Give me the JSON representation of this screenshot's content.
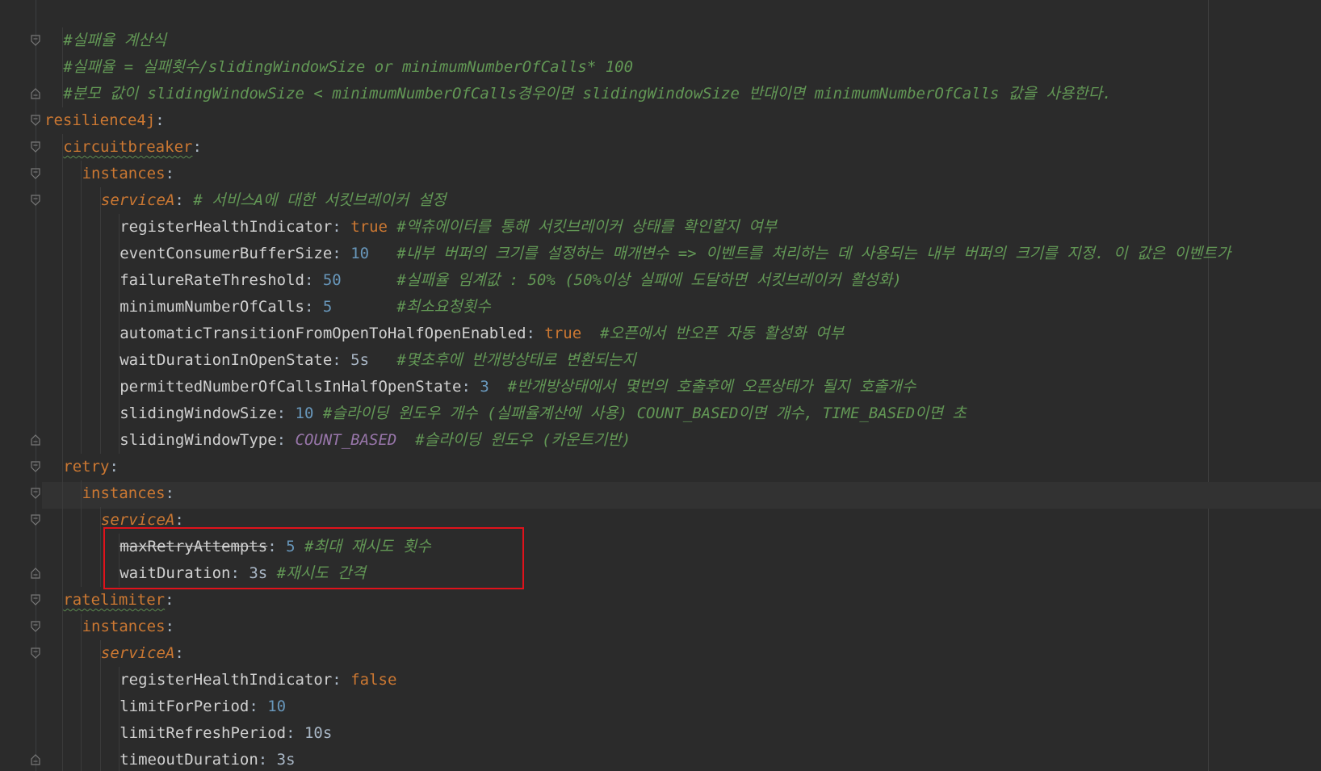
{
  "editor": {
    "language": "yaml",
    "colors": {
      "background": "#2b2b2b",
      "comment": "#629755",
      "key": "#cc7832",
      "number": "#6897bb",
      "enum": "#9876aa",
      "text": "#a9b7c6",
      "highlight_box": "#e0121b"
    },
    "lines": [
      {
        "indent": 1,
        "fold": "open",
        "segments": [
          {
            "cls": "c",
            "text": "#실패율 계산식"
          }
        ]
      },
      {
        "indent": 1,
        "fold": "",
        "segments": [
          {
            "cls": "c",
            "text": "#실패율 = 실패횟수/slidingWindowSize or minimumNumberOfCalls* 100"
          }
        ]
      },
      {
        "indent": 1,
        "fold": "close",
        "segments": [
          {
            "cls": "c",
            "text": "#분모 값이 slidingWindowSize < minimumNumberOfCalls경우이면 slidingWindowSize 반대이면 minimumNumberOfCalls 값을 사용한다."
          }
        ]
      },
      {
        "indent": 0,
        "fold": "open",
        "segments": [
          {
            "cls": "k",
            "text": "resilience4j"
          },
          {
            "cls": "p",
            "text": ":"
          }
        ]
      },
      {
        "indent": 1,
        "fold": "open",
        "segments": [
          {
            "cls": "k sq",
            "text": "circuitbreaker"
          },
          {
            "cls": "p",
            "text": ":"
          }
        ]
      },
      {
        "indent": 2,
        "fold": "open",
        "segments": [
          {
            "cls": "k",
            "text": "instances"
          },
          {
            "cls": "p",
            "text": ":"
          }
        ]
      },
      {
        "indent": 3,
        "fold": "open",
        "segments": [
          {
            "cls": "ki",
            "text": "serviceA"
          },
          {
            "cls": "p",
            "text": ": "
          },
          {
            "cls": "c",
            "text": "# 서비스A에 대한 서킷브레이커 설정"
          }
        ]
      },
      {
        "indent": 4,
        "fold": "",
        "segments": [
          {
            "cls": "keyc",
            "text": "registerHealthIndicator"
          },
          {
            "cls": "p",
            "text": ": "
          },
          {
            "cls": "bool",
            "text": "true"
          },
          {
            "cls": "p",
            "text": " "
          },
          {
            "cls": "c",
            "text": "#액츄에이터를 통해 서킷브레이커 상태를 확인할지 여부"
          }
        ]
      },
      {
        "indent": 4,
        "fold": "",
        "segments": [
          {
            "cls": "keyc",
            "text": "eventConsumerBufferSize"
          },
          {
            "cls": "p",
            "text": ": "
          },
          {
            "cls": "num",
            "text": "10"
          },
          {
            "cls": "p",
            "text": "   "
          },
          {
            "cls": "c",
            "text": "#내부 버퍼의 크기를 설정하는 매개변수 => 이벤트를 처리하는 데 사용되는 내부 버퍼의 크기를 지정. 이 값은 이벤트가"
          }
        ]
      },
      {
        "indent": 4,
        "fold": "",
        "segments": [
          {
            "cls": "keyc",
            "text": "failureRateThreshold"
          },
          {
            "cls": "p",
            "text": ": "
          },
          {
            "cls": "num",
            "text": "50"
          },
          {
            "cls": "p",
            "text": "      "
          },
          {
            "cls": "c",
            "text": "#실패율 임계값 : 50% (50%이상 실패에 도달하면 서킷브레이커 활성화)"
          }
        ]
      },
      {
        "indent": 4,
        "fold": "",
        "segments": [
          {
            "cls": "keyc",
            "text": "minimumNumberOfCalls"
          },
          {
            "cls": "p",
            "text": ": "
          },
          {
            "cls": "num",
            "text": "5"
          },
          {
            "cls": "p",
            "text": "       "
          },
          {
            "cls": "c",
            "text": "#최소요청횟수"
          }
        ]
      },
      {
        "indent": 4,
        "fold": "",
        "segments": [
          {
            "cls": "keyc",
            "text": "automaticTransitionFromOpenToHalfOpenEnabled"
          },
          {
            "cls": "p",
            "text": ": "
          },
          {
            "cls": "bool",
            "text": "true"
          },
          {
            "cls": "p",
            "text": "  "
          },
          {
            "cls": "c",
            "text": "#오픈에서 반오픈 자동 활성화 여부"
          }
        ]
      },
      {
        "indent": 4,
        "fold": "",
        "segments": [
          {
            "cls": "keyc",
            "text": "waitDurationInOpenState"
          },
          {
            "cls": "p",
            "text": ": 5s   "
          },
          {
            "cls": "c",
            "text": "#몇초후에 반개방상태로 변환되는지"
          }
        ]
      },
      {
        "indent": 4,
        "fold": "",
        "segments": [
          {
            "cls": "keyc",
            "text": "permittedNumberOfCallsInHalfOpenState"
          },
          {
            "cls": "p",
            "text": ": "
          },
          {
            "cls": "num",
            "text": "3"
          },
          {
            "cls": "p",
            "text": "  "
          },
          {
            "cls": "c",
            "text": "#반개방상태에서 몇번의 호출후에 오픈상태가 될지 호출개수"
          }
        ]
      },
      {
        "indent": 4,
        "fold": "",
        "segments": [
          {
            "cls": "keyc",
            "text": "slidingWindowSize"
          },
          {
            "cls": "p",
            "text": ": "
          },
          {
            "cls": "num",
            "text": "10"
          },
          {
            "cls": "p",
            "text": " "
          },
          {
            "cls": "c",
            "text": "#슬라이딩 윈도우 개수 (실패율계산에 사용) COUNT_BASED이면 개수, TIME_BASED이면 초"
          }
        ]
      },
      {
        "indent": 4,
        "fold": "close",
        "segments": [
          {
            "cls": "keyc",
            "text": "slidingWindowType"
          },
          {
            "cls": "p",
            "text": ": "
          },
          {
            "cls": "en",
            "text": "COUNT_BASED"
          },
          {
            "cls": "p",
            "text": "  "
          },
          {
            "cls": "c",
            "text": "#슬라이딩 윈도우 (카운트기반)"
          }
        ]
      },
      {
        "indent": 1,
        "fold": "open",
        "segments": [
          {
            "cls": "k",
            "text": "retry"
          },
          {
            "cls": "p",
            "text": ":"
          }
        ]
      },
      {
        "indent": 2,
        "fold": "open",
        "segments": [
          {
            "cls": "k",
            "text": "instances"
          },
          {
            "cls": "p",
            "text": ":"
          }
        ]
      },
      {
        "indent": 3,
        "fold": "open",
        "segments": [
          {
            "cls": "ki",
            "text": "serviceA"
          },
          {
            "cls": "p",
            "text": ":"
          }
        ]
      },
      {
        "indent": 4,
        "fold": "",
        "segments": [
          {
            "cls": "keyc strike",
            "text": "maxRetryAttempts"
          },
          {
            "cls": "p",
            "text": ": "
          },
          {
            "cls": "num",
            "text": "5"
          },
          {
            "cls": "p",
            "text": " "
          },
          {
            "cls": "c",
            "text": "#최대 재시도 횟수"
          }
        ]
      },
      {
        "indent": 4,
        "fold": "close",
        "segments": [
          {
            "cls": "keyc",
            "text": "waitDuration"
          },
          {
            "cls": "p",
            "text": ": 3s "
          },
          {
            "cls": "c",
            "text": "#재시도 간격"
          }
        ]
      },
      {
        "indent": 1,
        "fold": "open",
        "segments": [
          {
            "cls": "k sq",
            "text": "ratelimiter"
          },
          {
            "cls": "p",
            "text": ":"
          }
        ]
      },
      {
        "indent": 2,
        "fold": "open",
        "segments": [
          {
            "cls": "k",
            "text": "instances"
          },
          {
            "cls": "p",
            "text": ":"
          }
        ]
      },
      {
        "indent": 3,
        "fold": "open",
        "segments": [
          {
            "cls": "ki",
            "text": "serviceA"
          },
          {
            "cls": "p",
            "text": ":"
          }
        ]
      },
      {
        "indent": 4,
        "fold": "",
        "segments": [
          {
            "cls": "keyc",
            "text": "registerHealthIndicator"
          },
          {
            "cls": "p",
            "text": ": "
          },
          {
            "cls": "bool",
            "text": "false"
          }
        ]
      },
      {
        "indent": 4,
        "fold": "",
        "segments": [
          {
            "cls": "keyc",
            "text": "limitForPeriod"
          },
          {
            "cls": "p",
            "text": ": "
          },
          {
            "cls": "num",
            "text": "10"
          }
        ]
      },
      {
        "indent": 4,
        "fold": "",
        "segments": [
          {
            "cls": "keyc",
            "text": "limitRefreshPeriod"
          },
          {
            "cls": "p",
            "text": ": 10s"
          }
        ]
      },
      {
        "indent": 4,
        "fold": "close",
        "segments": [
          {
            "cls": "keyc",
            "text": "timeoutDuration"
          },
          {
            "cls": "p",
            "text": ": 3s"
          }
        ]
      }
    ]
  }
}
